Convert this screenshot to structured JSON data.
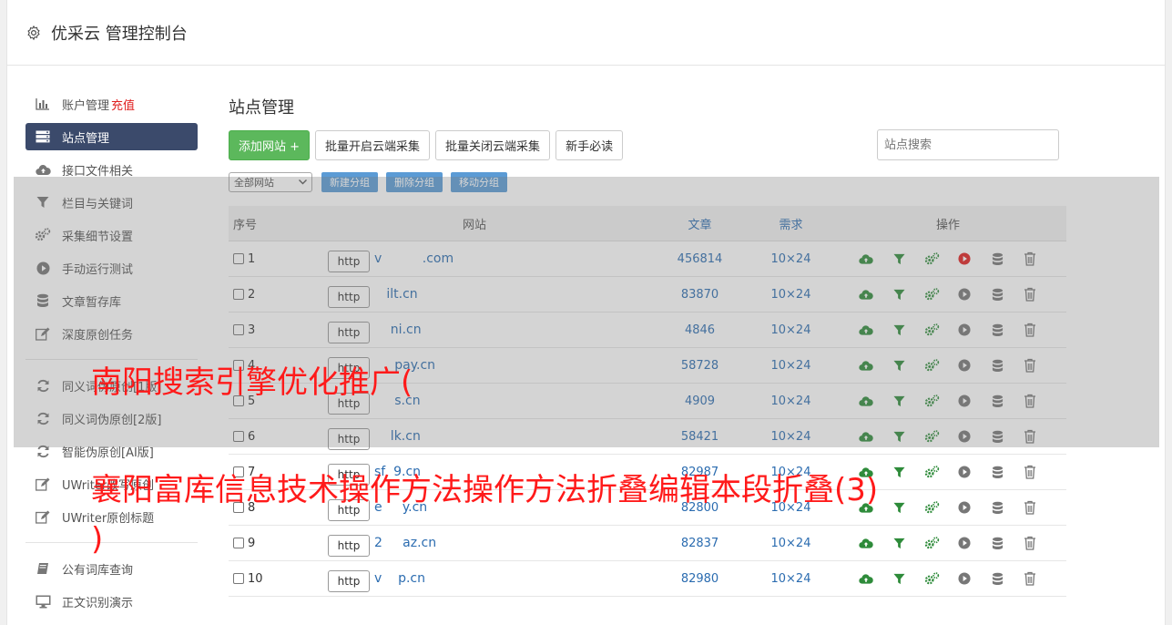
{
  "header": {
    "title": "优采云 管理控制台",
    "icon": "gear-icon"
  },
  "sidebar": {
    "items": [
      {
        "label": "账户管理",
        "badge": "充值",
        "icon": "bar-chart-icon"
      },
      {
        "label": "站点管理",
        "icon": "server-icon",
        "active": true
      },
      {
        "label": "接口文件相关",
        "icon": "cloud-upload-icon"
      },
      {
        "label": "栏目与关键词",
        "icon": "filter-icon"
      },
      {
        "label": "采集细节设置",
        "icon": "gears-icon"
      },
      {
        "label": "手动运行测试",
        "icon": "play-icon"
      },
      {
        "label": "文章暂存库",
        "icon": "database-icon"
      },
      {
        "label": "深度原创任务",
        "icon": "edit-icon"
      },
      {
        "label": "同义词伪原创[1版]",
        "icon": "refresh-icon"
      },
      {
        "label": "同义词伪原创[2版]",
        "icon": "refresh-icon"
      },
      {
        "label": "智能伪原创[AI版]",
        "icon": "refresh-icon"
      },
      {
        "label": "UWriter改写原创",
        "icon": "edit-icon"
      },
      {
        "label": "UWriter原创标题",
        "icon": "edit-icon"
      },
      {
        "label": "公有词库查询",
        "icon": "book-icon"
      },
      {
        "label": "正文识别演示",
        "icon": "monitor-icon"
      }
    ]
  },
  "main": {
    "title": "站点管理",
    "toolbar": {
      "add": "添加网站 +",
      "batch_open": "批量开启云端采集",
      "batch_close": "批量关闭云端采集",
      "guide": "新手必读",
      "search_placeholder": "站点搜索"
    },
    "group_bar": {
      "select": "全部网站",
      "new_group": "新建分组",
      "delete_group": "删除分组",
      "move_group": "移动分组"
    },
    "table": {
      "headers": [
        "序号",
        "网站",
        "文章",
        "需求",
        "操作"
      ],
      "rows": [
        {
          "no": "1",
          "proto": "http",
          "site": "v          .com",
          "articles": "456814",
          "need": "10×24",
          "run_active": true
        },
        {
          "no": "2",
          "proto": "http",
          "site": "   ilt.cn",
          "articles": "83870",
          "need": "10×24",
          "run_active": false
        },
        {
          "no": "3",
          "proto": "http",
          "site": "    ni.cn",
          "articles": "4846",
          "need": "10×24",
          "run_active": false
        },
        {
          "no": "4",
          "proto": "http",
          "site": "     pay.cn",
          "articles": "58728",
          "need": "10×24",
          "run_active": false
        },
        {
          "no": "5",
          "proto": "http",
          "site": "     s.cn",
          "articles": "4909",
          "need": "10×24",
          "run_active": false
        },
        {
          "no": "6",
          "proto": "http",
          "site": "    lk.cn",
          "articles": "58421",
          "need": "10×24",
          "run_active": false
        },
        {
          "no": "7",
          "proto": "http",
          "site": "sf  9.cn",
          "articles": "82987",
          "need": "10×24",
          "run_active": false
        },
        {
          "no": "8",
          "proto": "http",
          "site": "e     y.cn",
          "articles": "82800",
          "need": "10×24",
          "run_active": false
        },
        {
          "no": "9",
          "proto": "http",
          "site": "2     az.cn",
          "articles": "82837",
          "need": "10×24",
          "run_active": false
        },
        {
          "no": "10",
          "proto": "http",
          "site": "v    p.cn",
          "articles": "82980",
          "need": "10×24",
          "run_active": false
        }
      ]
    }
  },
  "watermark": {
    "line1": "南阳搜索引擎优化推广(",
    "line2": "襄阳富库信息技术操作方法操作方法折叠编辑本段折叠(3)",
    "line3": ")"
  },
  "colors": {
    "accent": "#3b4a6b",
    "green": "#5cb85c",
    "link": "#2b6cb0",
    "watermark": "#ff1a1a",
    "small_btn": "#5b9bd5"
  }
}
